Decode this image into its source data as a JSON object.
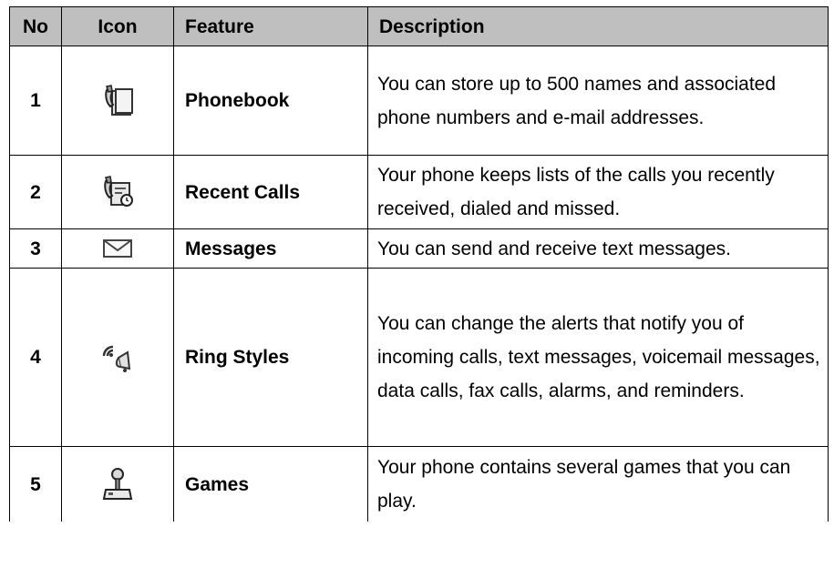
{
  "headers": {
    "no": "No",
    "icon": "Icon",
    "feature": "Feature",
    "description": "Description"
  },
  "rows": [
    {
      "no": "1",
      "icon": "phonebook-icon",
      "feature": "Phonebook",
      "description": "You can store up to 500 names and associated phone numbers and e-mail addresses."
    },
    {
      "no": "2",
      "icon": "recent-calls-icon",
      "feature": "Recent Calls",
      "description": "Your phone keeps lists of the calls you recently received, dialed and missed."
    },
    {
      "no": "3",
      "icon": "envelope-icon",
      "feature": "Messages",
      "description": "You can send and receive text messages."
    },
    {
      "no": "4",
      "icon": "ring-styles-icon",
      "feature": "Ring Styles",
      "description": "You can change the alerts that notify you of incoming calls, text messages, voicemail messages, data calls, fax calls, alarms, and reminders."
    },
    {
      "no": "5",
      "icon": "joystick-icon",
      "feature": "Games",
      "description": "Your phone contains several games that you can play."
    }
  ],
  "colors": {
    "header_bg": "#bfbfbf",
    "border": "#000000"
  }
}
